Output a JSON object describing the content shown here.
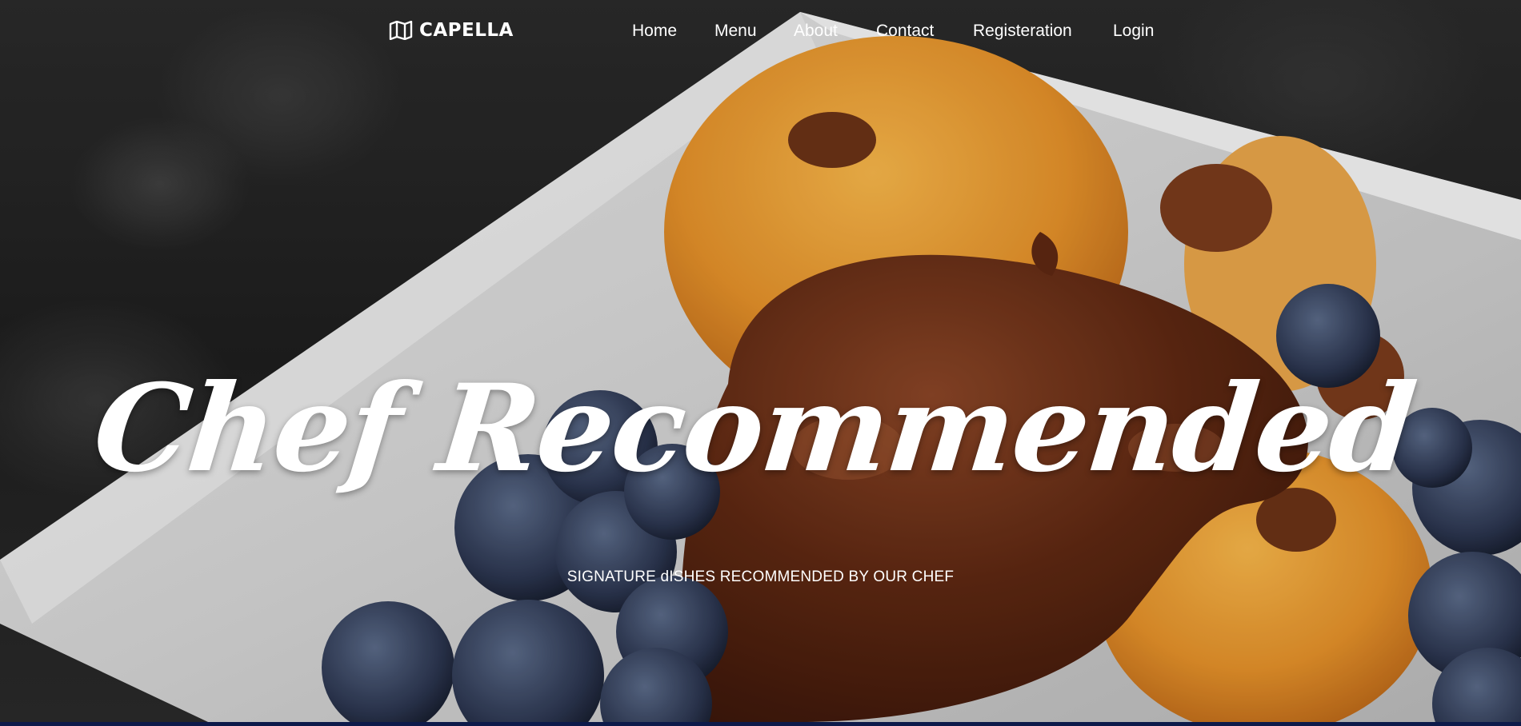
{
  "brand": {
    "name": "CAPELLA",
    "icon": "map-icon"
  },
  "nav": {
    "home": "Home",
    "menu": "Menu",
    "about": "About",
    "contact": "Contact",
    "registration": "Registeration",
    "login": "Login"
  },
  "hero": {
    "title": "Chef Recommended",
    "subtitle": "SIGNATURE dISHES RECOMMENDED BY OUR CHEF"
  },
  "colors": {
    "text": "#ffffff",
    "bottom_bar": "#0d1a4a"
  }
}
